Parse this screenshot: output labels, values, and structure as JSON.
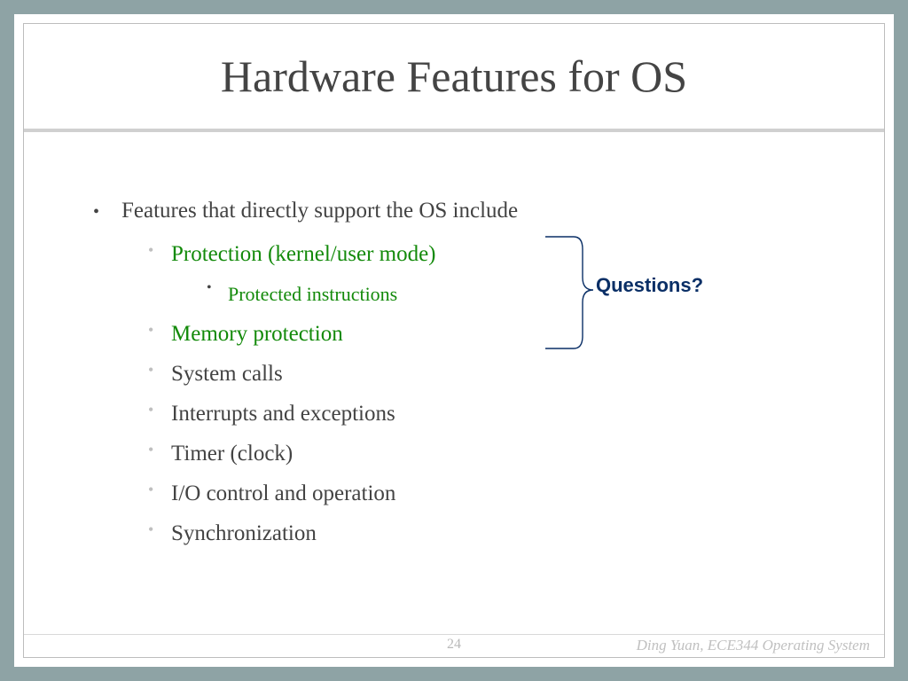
{
  "title": "Hardware Features for OS",
  "intro": "Features that directly support the OS include",
  "items": {
    "protection": "Protection (kernel/user mode)",
    "protected_instr": "Protected instructions",
    "memory": "Memory protection",
    "syscalls": "System calls",
    "interrupts": "Interrupts and exceptions",
    "timer": "Timer (clock)",
    "io": "I/O control and operation",
    "sync": "Synchronization"
  },
  "callout": "Questions?",
  "page_number": "24",
  "author_line": "Ding Yuan, ECE344 Operating System"
}
